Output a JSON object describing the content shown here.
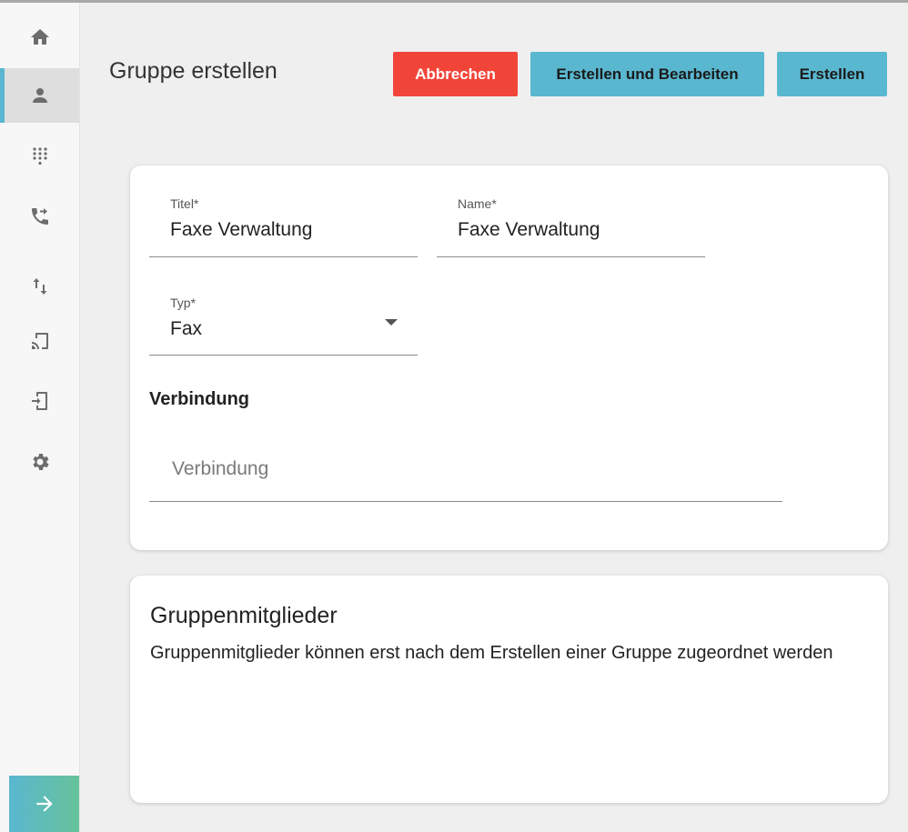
{
  "header": {
    "title": "Gruppe erstellen",
    "cancel_label": "Abbrechen",
    "create_edit_label": "Erstellen und Bearbeiten",
    "create_label": "Erstellen"
  },
  "sidebar": {
    "items": [
      {
        "icon": "home-icon"
      },
      {
        "icon": "person-icon",
        "active": true
      },
      {
        "icon": "dialpad-icon"
      },
      {
        "icon": "call-forward-icon"
      },
      {
        "icon": "transfer-arrows-icon"
      },
      {
        "icon": "cast-icon"
      },
      {
        "icon": "device-login-icon"
      },
      {
        "icon": "gear-icon"
      }
    ],
    "expand_icon": "arrow-right-icon"
  },
  "form": {
    "title_label": "Titel*",
    "title_value": "Faxe Verwaltung",
    "name_label": "Name*",
    "name_value": "Faxe Verwaltung",
    "type_label": "Typ*",
    "type_value": "Fax",
    "connection_heading": "Verbindung",
    "connection_placeholder": "Verbindung"
  },
  "members": {
    "title": "Gruppenmitglieder",
    "text": "Gruppenmitglieder können erst nach dem Erstellen einer Gruppe zugeordnet werden"
  },
  "colors": {
    "accent": "#5ab7d0",
    "danger": "#f2453a",
    "background": "#efefef"
  }
}
